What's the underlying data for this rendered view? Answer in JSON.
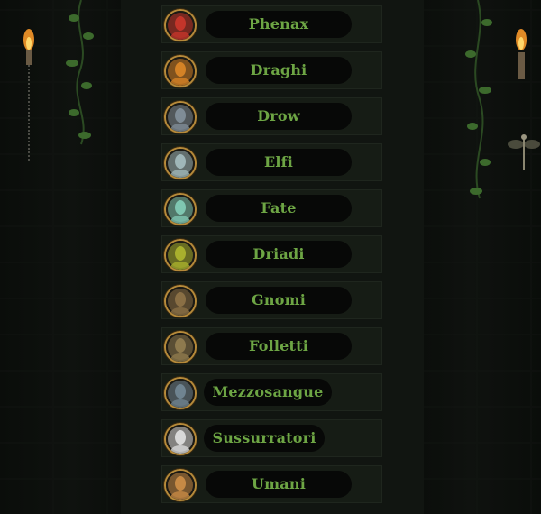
{
  "races": [
    {
      "label": "Phenax",
      "icon": "phenax-portrait-icon",
      "tone": "#c4352a"
    },
    {
      "label": "Draghi",
      "icon": "dragon-portrait-icon",
      "tone": "#d48226"
    },
    {
      "label": "Drow",
      "icon": "drow-portrait-icon",
      "tone": "#7f8c96"
    },
    {
      "label": "Elfi",
      "icon": "elf-portrait-icon",
      "tone": "#9fb6b8"
    },
    {
      "label": "Fate",
      "icon": "fairy-portrait-icon",
      "tone": "#7fc6b1"
    },
    {
      "label": "Driadi",
      "icon": "dryad-portrait-icon",
      "tone": "#a8b02d"
    },
    {
      "label": "Gnomi",
      "icon": "gnome-portrait-icon",
      "tone": "#8a6f45"
    },
    {
      "label": "Folletti",
      "icon": "goblin-portrait-icon",
      "tone": "#8e7a4e"
    },
    {
      "label": "Mezzosangue",
      "icon": "half-blood-portrait-icon",
      "tone": "#6f8390"
    },
    {
      "label": "Sussurratori",
      "icon": "whisperer-portrait-icon",
      "tone": "#d8d8d8"
    },
    {
      "label": "Umani",
      "icon": "human-portrait-icon",
      "tone": "#c78a45"
    }
  ],
  "colors": {
    "label": "#6da544",
    "frame": "#b68a3a",
    "pill": "#070807"
  }
}
